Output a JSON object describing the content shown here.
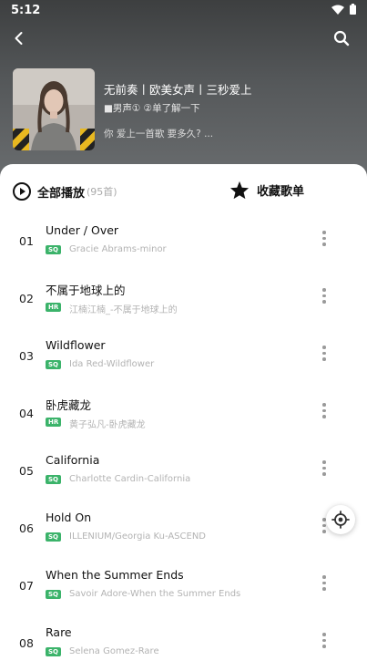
{
  "status": {
    "time": "5:12"
  },
  "playlist": {
    "title": "无前奏丨欧美女声丨三秒爱上",
    "creator": "■男声① ②单了解一下",
    "description": "你 爱上一首歌 要多久? ..."
  },
  "actions": {
    "play_all_label": "全部播放",
    "play_all_count": "(95首)",
    "collect_label": "收藏歌单"
  },
  "songs": [
    {
      "index": "01",
      "title": "Under / Over",
      "badge": "SQ",
      "subtitle": "Gracie Abrams-minor"
    },
    {
      "index": "02",
      "title": "不属于地球上的",
      "badge": "HR",
      "subtitle": "江楠江楠_-不属于地球上的"
    },
    {
      "index": "03",
      "title": "Wildflower",
      "badge": "SQ",
      "subtitle": "Ida Red-Wildflower"
    },
    {
      "index": "04",
      "title": "卧虎藏龙",
      "badge": "HR",
      "subtitle": "黄子弘凡-卧虎藏龙"
    },
    {
      "index": "05",
      "title": "California",
      "badge": "SQ",
      "subtitle": "Charlotte Cardin-California"
    },
    {
      "index": "06",
      "title": "Hold On",
      "badge": "SQ",
      "subtitle": "ILLENIUM/Georgia Ku-ASCEND"
    },
    {
      "index": "07",
      "title": "When the Summer Ends",
      "badge": "SQ",
      "subtitle": "Savoir Adore-When the Summer Ends"
    },
    {
      "index": "08",
      "title": "Rare",
      "badge": "SQ",
      "subtitle": "Selena Gomez-Rare"
    }
  ],
  "icons": {
    "back": "back-arrow-icon",
    "search": "search-icon",
    "play": "play-circle-icon",
    "star": "star-icon",
    "more": "more-vertical-icon",
    "locate": "locate-icon",
    "wifi": "wifi-icon",
    "battery": "battery-icon"
  },
  "colors": {
    "badge": "#3bb36a",
    "header_bg": "#55585a"
  }
}
